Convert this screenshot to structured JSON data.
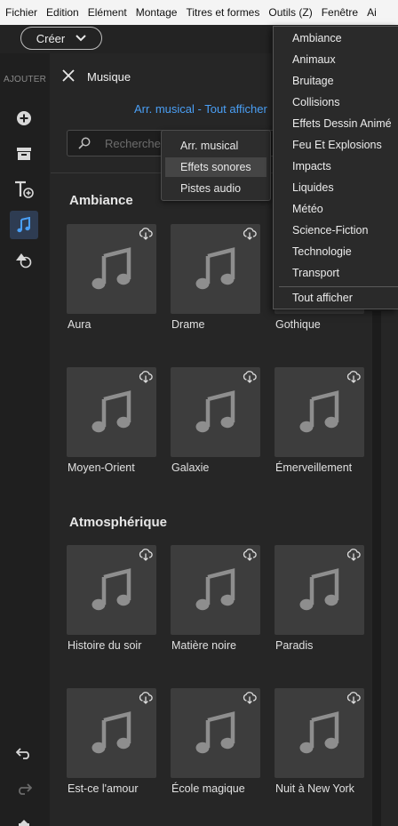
{
  "menubar": {
    "items": [
      "Fichier",
      "Edition",
      "Elément",
      "Montage",
      "Titres et formes",
      "Outils (Z)",
      "Fenêtre",
      "Ai"
    ]
  },
  "toolbar": {
    "create_label": "Créer"
  },
  "rail": {
    "title": "AJOUTER"
  },
  "panel": {
    "title": "Musique",
    "breadcrumb": "Arr. musical - Tout afficher",
    "search_placeholder": "Rechercher"
  },
  "category_popup": {
    "options": [
      "Arr. musical",
      "Effets sonores",
      "Pistes audio"
    ],
    "selected": "Effets sonores"
  },
  "dropdown": {
    "items": [
      "Ambiance",
      "Animaux",
      "Bruitage",
      "Collisions",
      "Effets Dessin Animé",
      "Feu Et Explosions",
      "Impacts",
      "Liquides",
      "Météo",
      "Science-Fiction",
      "Technologie",
      "Transport"
    ],
    "footer": "Tout afficher"
  },
  "sections": [
    {
      "title": "Ambiance",
      "tracks": [
        "Aura",
        "Drame",
        "Gothique",
        "Moyen-Orient",
        "Galaxie",
        "Émerveillement"
      ]
    },
    {
      "title": "Atmosphérique",
      "tracks": [
        "Histoire du soir",
        "Matière noire",
        "Paradis",
        "Est-ce l'amour",
        "École magique",
        "Nuit à New York"
      ]
    }
  ],
  "colors": {
    "accent": "#4a9ff5",
    "card": "#3d3d3d",
    "note": "#8e8e8e"
  }
}
